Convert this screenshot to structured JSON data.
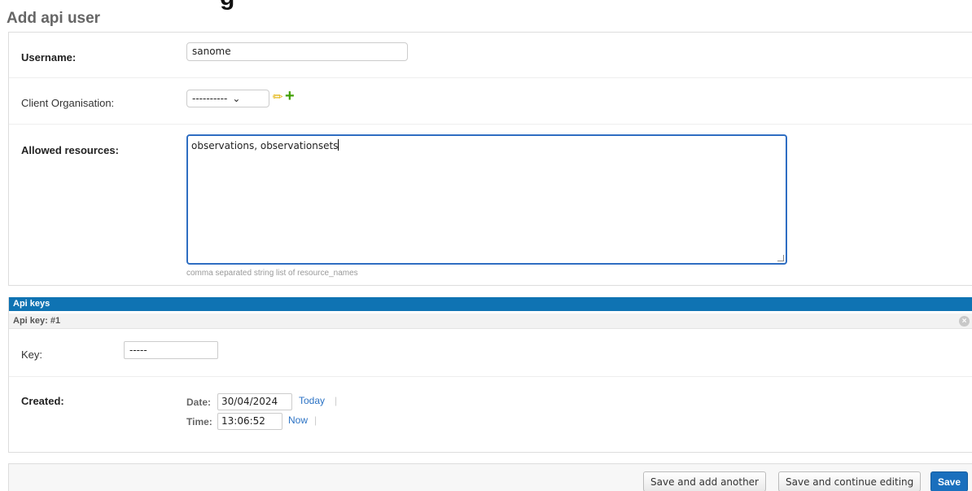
{
  "page": {
    "heading_cut": "g",
    "title": "Add api user"
  },
  "form": {
    "username": {
      "label": "Username:",
      "value": "sanome"
    },
    "client_organisation": {
      "label": "Client Organisation:",
      "selected": "----------"
    },
    "allowed_resources": {
      "label": "Allowed resources:",
      "value": "observations, observationsets",
      "help": "comma separated string list of resource_names"
    }
  },
  "api_keys": {
    "header": "Api keys",
    "item_title": "Api key: #1",
    "key": {
      "label": "Key:",
      "value": "-----"
    },
    "created": {
      "label": "Created:",
      "date_label": "Date:",
      "date_value": "30/04/2024",
      "today": "Today",
      "time_label": "Time:",
      "time_value": "13:06:52",
      "now": "Now",
      "separator": "|"
    }
  },
  "submit": {
    "save_add_another": "Save and add another",
    "save_continue": "Save and continue editing",
    "save": "Save"
  },
  "colors": {
    "accent": "#0f73b3",
    "primary_button": "#1a6fbd",
    "link": "#2b72c4"
  }
}
